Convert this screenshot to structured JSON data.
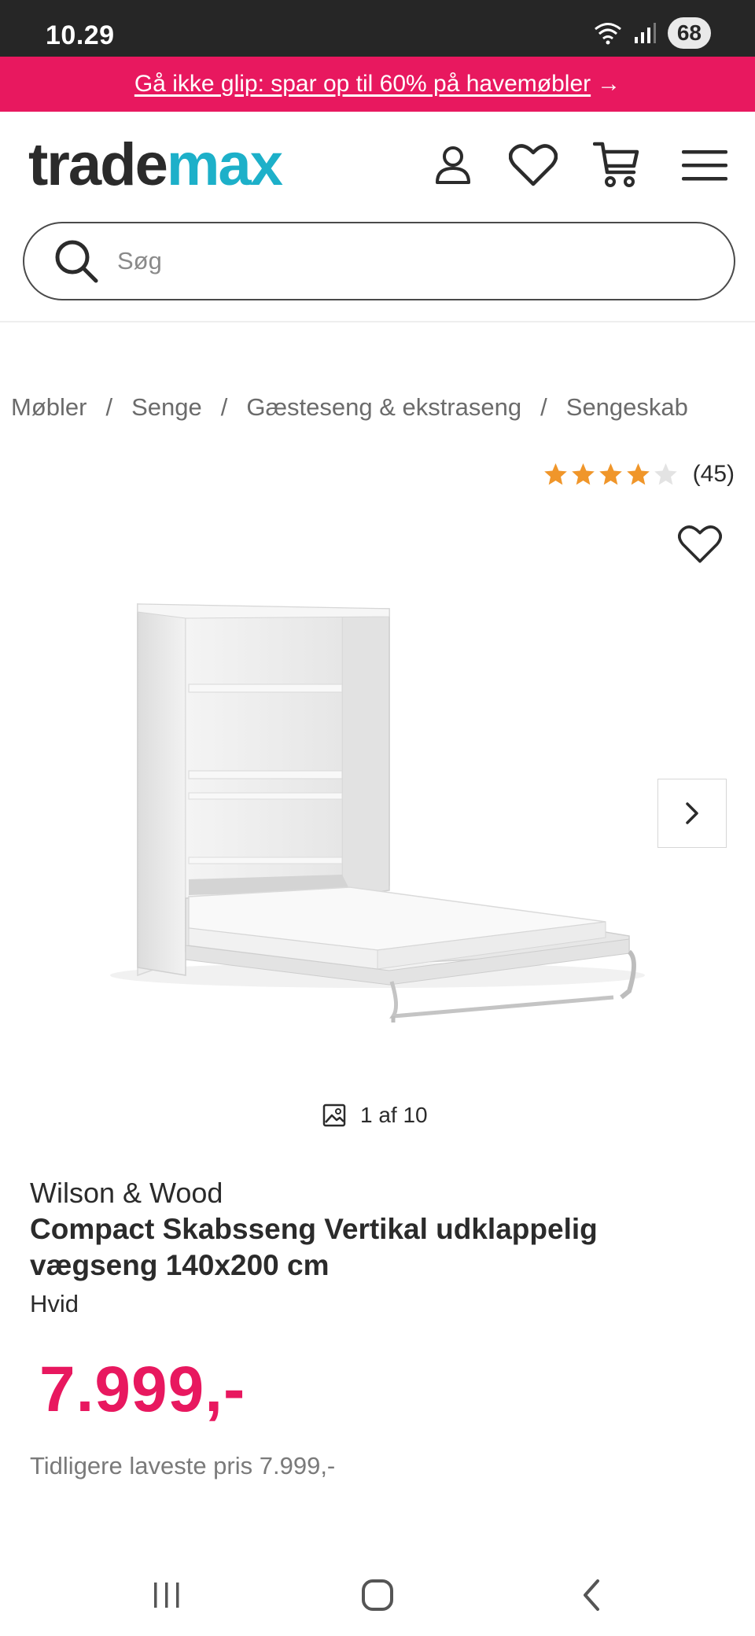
{
  "status_bar": {
    "time": "10.29",
    "battery": "68"
  },
  "promo": {
    "text": "Gå ikke glip: spar op til 60% på havemøbler",
    "arrow": "→"
  },
  "header": {
    "logo_part1": "trade",
    "logo_part2": "max",
    "icons": [
      "account-icon",
      "heart-icon",
      "cart-icon",
      "menu-icon"
    ]
  },
  "search": {
    "placeholder": "Søg"
  },
  "breadcrumb": [
    "Møbler",
    "Senge",
    "Gæsteseng & ekstraseng",
    "Sengeskab"
  ],
  "breadcrumb_sep": "/",
  "rating": {
    "stars": 4,
    "max": 5,
    "count": "(45)"
  },
  "gallery": {
    "counter": "1 af 10"
  },
  "product": {
    "brand": "Wilson & Wood",
    "title": "Compact Skabsseng Vertikal udklappelig vægseng 140x200 cm",
    "variant": "Hvid",
    "price": "7.999,-",
    "previous_price": "Tidligere laveste pris 7.999,-"
  },
  "colors": {
    "accent": "#e8185f",
    "logo_teal": "#1db0c9",
    "star": "#f0962a",
    "text": "#2b2b2b"
  }
}
